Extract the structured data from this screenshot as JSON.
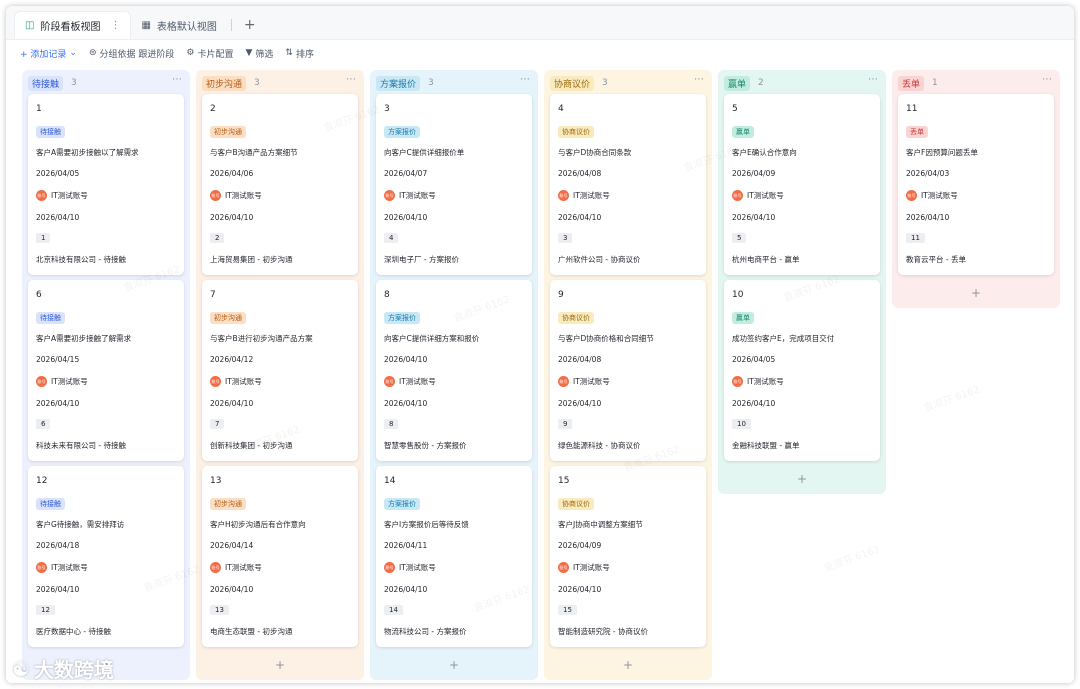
{
  "tabs": [
    {
      "label": "阶段看板视图",
      "icon": "kanban-icon",
      "active": true
    },
    {
      "label": "表格默认视图",
      "icon": "grid-icon",
      "active": false
    }
  ],
  "toolbar": {
    "add_record": "+ 添加记录",
    "group_by": "分组依据 跟进阶段",
    "card_config": "卡片配置",
    "filter": "筛选",
    "sort": "排序"
  },
  "owner_name": "IT测试账号",
  "avatar_text": "账号",
  "watermark": "袁淑芬 6162",
  "brand": "大数跨境",
  "columns": [
    {
      "name": "待接触",
      "count": "3",
      "bg": "#edf1fd",
      "tag_bg": "#d9e3fb",
      "tag_color": "#2f5bd7",
      "cards": [
        {
          "num": "1",
          "tag": "待接触",
          "desc": "客户A需要初步接触以了解需求",
          "date1": "2026/04/05",
          "date2": "2026/04/10",
          "id": "1",
          "company": "北京科技有限公司 - 待接触"
        },
        {
          "num": "6",
          "tag": "待接触",
          "desc": "客户A需要初步接触了解需求",
          "date1": "2026/04/15",
          "date2": "2026/04/10",
          "id": "6",
          "company": "科技未来有限公司 - 待接触"
        },
        {
          "num": "12",
          "tag": "待接触",
          "desc": "客户G待接触，需安排拜访",
          "date1": "2026/04/18",
          "date2": "2026/04/10",
          "id": "12",
          "company": "医疗数据中心 - 待接触"
        }
      ]
    },
    {
      "name": "初步沟通",
      "count": "3",
      "bg": "#fdf0e4",
      "tag_bg": "#fbdfc5",
      "tag_color": "#b8580f",
      "cards": [
        {
          "num": "2",
          "tag": "初步沟通",
          "desc": "与客户B沟通产品方案细节",
          "date1": "2026/04/06",
          "date2": "2026/04/10",
          "id": "2",
          "company": "上海贸易集团 - 初步沟通"
        },
        {
          "num": "7",
          "tag": "初步沟通",
          "desc": "与客户B进行初步沟通产品方案",
          "date1": "2026/04/12",
          "date2": "2026/04/10",
          "id": "7",
          "company": "创新科技集团 - 初步沟通"
        },
        {
          "num": "13",
          "tag": "初步沟通",
          "desc": "客户H初步沟通后有合作意向",
          "date1": "2026/04/14",
          "date2": "2026/04/10",
          "id": "13",
          "company": "电商生态联盟 - 初步沟通"
        }
      ]
    },
    {
      "name": "方案报价",
      "count": "3",
      "bg": "#e5f4fb",
      "tag_bg": "#c9e8f6",
      "tag_color": "#1778a8",
      "cards": [
        {
          "num": "3",
          "tag": "方案报价",
          "desc": "向客户C提供详细报价单",
          "date1": "2026/04/07",
          "date2": "2026/04/10",
          "id": "4",
          "company": "深圳电子厂 - 方案报价"
        },
        {
          "num": "8",
          "tag": "方案报价",
          "desc": "向客户C提供详细方案和报价",
          "date1": "2026/04/10",
          "date2": "2026/04/10",
          "id": "8",
          "company": "智慧零售股份 - 方案报价"
        },
        {
          "num": "14",
          "tag": "方案报价",
          "desc": "客户I方案报价后等待反馈",
          "date1": "2026/04/11",
          "date2": "2026/04/10",
          "id": "14",
          "company": "物流科技公司 - 方案报价"
        }
      ]
    },
    {
      "name": "协商议价",
      "count": "3",
      "bg": "#fdf5e2",
      "tag_bg": "#faeac0",
      "tag_color": "#9a6b0c",
      "cards": [
        {
          "num": "4",
          "tag": "协商议价",
          "desc": "与客户D协商合同条款",
          "date1": "2026/04/08",
          "date2": "2026/04/10",
          "id": "3",
          "company": "广州软件公司 - 协商议价"
        },
        {
          "num": "9",
          "tag": "协商议价",
          "desc": "与客户D协商价格和合同细节",
          "date1": "2026/04/08",
          "date2": "2026/04/10",
          "id": "9",
          "company": "绿色能源科技 - 协商议价"
        },
        {
          "num": "15",
          "tag": "协商议价",
          "desc": "客户J协商中调整方案细节",
          "date1": "2026/04/09",
          "date2": "2026/04/10",
          "id": "15",
          "company": "智能制造研究院 - 协商议价"
        }
      ]
    },
    {
      "name": "赢单",
      "count": "2",
      "bg": "#e3f6f1",
      "tag_bg": "#c3ece0",
      "tag_color": "#16866a",
      "cards": [
        {
          "num": "5",
          "tag": "赢单",
          "desc": "客户E确认合作意向",
          "date1": "2026/04/09",
          "date2": "2026/04/10",
          "id": "5",
          "company": "杭州电商平台 - 赢单"
        },
        {
          "num": "10",
          "tag": "赢单",
          "desc": "成功签约客户E，完成项目交付",
          "date1": "2026/04/05",
          "date2": "2026/04/10",
          "id": "10",
          "company": "金融科技联盟 - 赢单"
        }
      ]
    },
    {
      "name": "丢单",
      "count": "1",
      "bg": "#fdecec",
      "tag_bg": "#fad3d3",
      "tag_color": "#c93a3a",
      "cards": [
        {
          "num": "11",
          "tag": "丢单",
          "desc": "客户F因预算问题丢单",
          "date1": "2026/04/03",
          "date2": "2026/04/10",
          "id": "11",
          "company": "教育云平台 - 丢单"
        }
      ]
    }
  ]
}
